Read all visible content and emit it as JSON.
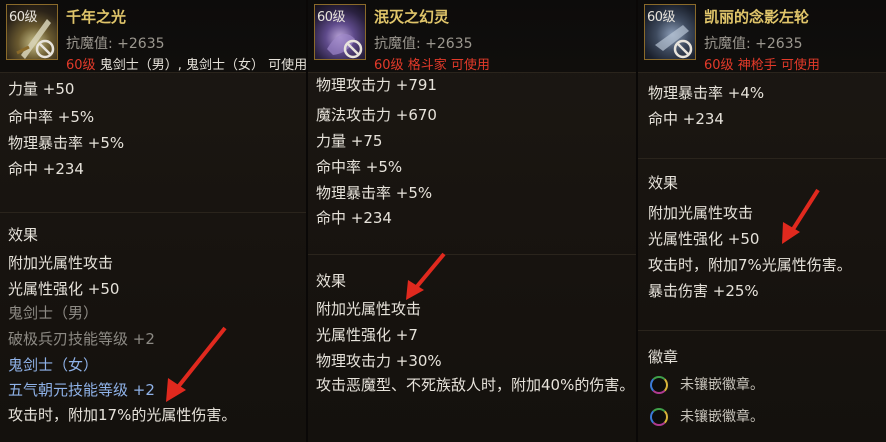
{
  "colors": {
    "item_name": "#e0c56a",
    "requirement": "#e23a2a",
    "stat_text": "#e6e2da",
    "inactive_text": "#8d8a84",
    "active_class_text": "#8fb2e8",
    "annotation_arrow": "#e0291e"
  },
  "panels": [
    {
      "level": "60级",
      "name": "千年之光",
      "resist": "抗魔值: +2635",
      "req_level": "60级",
      "req_classes": "鬼剑士（男）, 鬼剑士（女） 可使用",
      "stats": [
        "力量 +50",
        "命中率 +5%",
        "物理暴击率 +5%",
        "命中 +234"
      ],
      "effects_title": "效果",
      "effects": [
        {
          "text": "附加光属性攻击",
          "style": "normal"
        },
        {
          "text": "光属性强化 +50",
          "style": "normal"
        },
        {
          "text": "鬼剑士（男）",
          "style": "gray"
        },
        {
          "text": "破极兵刃技能等级 +2",
          "style": "gray"
        },
        {
          "text": "鬼剑士（女）",
          "style": "blue"
        },
        {
          "text": "五气朝元技能等级 +2",
          "style": "blue"
        },
        {
          "text": "攻击时，附加17%的光属性伤害。",
          "style": "normal"
        }
      ]
    },
    {
      "level": "60级",
      "name": "泯灭之幻灵",
      "resist": "抗魔值: +2635",
      "req_level": "60级",
      "req_classes": "格斗家 可使用",
      "stats": [
        "物理攻击力 +791",
        "魔法攻击力 +670",
        "力量 +75",
        "命中率 +5%",
        "物理暴击率 +5%",
        "命中 +234"
      ],
      "effects_title": "效果",
      "effects": [
        {
          "text": "附加光属性攻击",
          "style": "normal"
        },
        {
          "text": "光属性强化 +7",
          "style": "normal"
        },
        {
          "text": "物理攻击力 +30%",
          "style": "normal"
        },
        {
          "text": "攻击恶魔型、不死族敌人时，附加40%的伤害。",
          "style": "normal"
        }
      ]
    },
    {
      "level": "60级",
      "name": "凯丽的念影左轮",
      "resist": "抗魔值: +2635",
      "req_level": "60级",
      "req_classes": "神枪手 可使用",
      "stats": [
        "物理暴击率 +4%",
        "命中 +234"
      ],
      "effects_title": "效果",
      "effects": [
        {
          "text": "附加光属性攻击",
          "style": "normal"
        },
        {
          "text": "光属性强化 +50",
          "style": "normal"
        },
        {
          "text": "攻击时，附加7%光属性伤害。",
          "style": "normal"
        },
        {
          "text": "暴击伤害 +25%",
          "style": "normal"
        }
      ],
      "emblem_title": "徽章",
      "emblems": [
        "未镶嵌徽章。",
        "未镶嵌徽章。"
      ]
    }
  ]
}
